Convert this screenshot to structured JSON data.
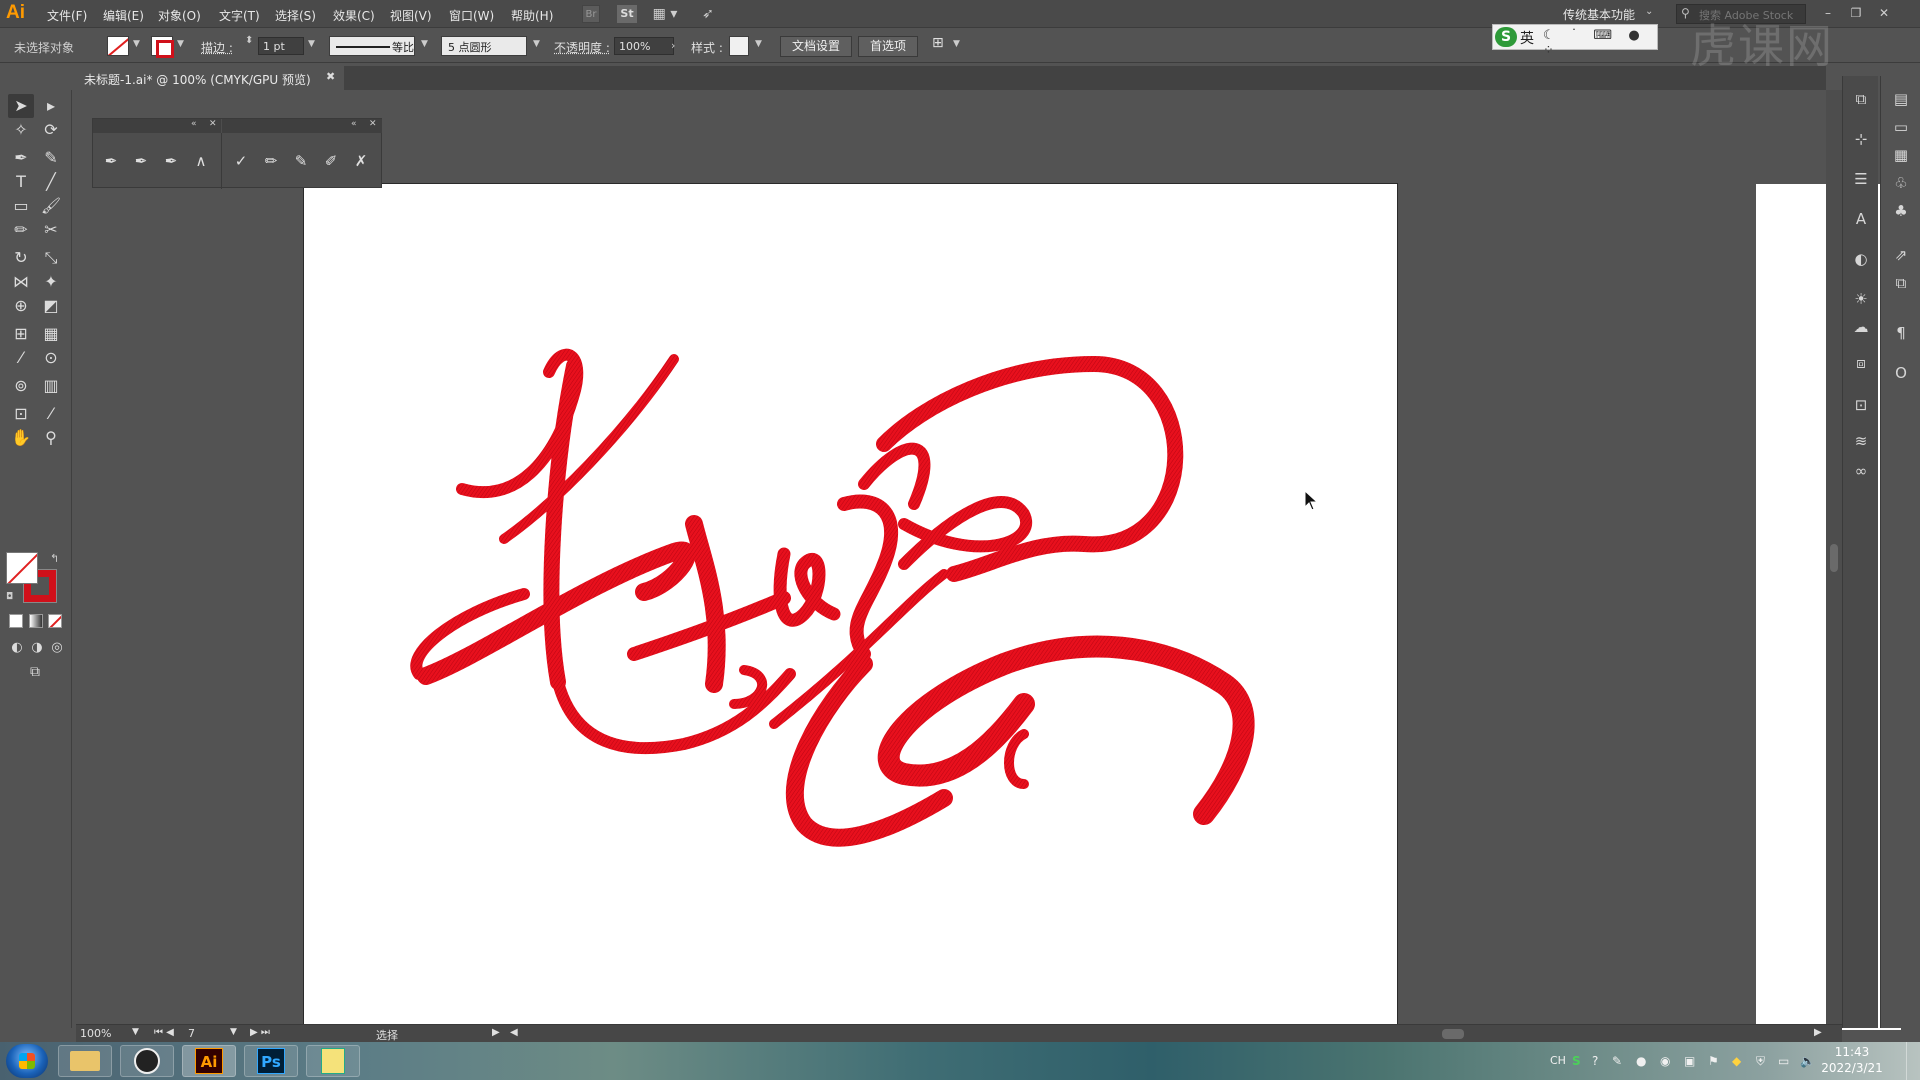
{
  "app": {
    "logo": "Ai",
    "menu": [
      "文件(F)",
      "编辑(E)",
      "对象(O)",
      "文字(T)",
      "选择(S)",
      "效果(C)",
      "视图(V)",
      "窗口(W)",
      "帮助(H)"
    ],
    "icons": [
      "bridge-icon",
      "stock-icon",
      "arrange-documents-icon",
      "gpu-performance-icon"
    ],
    "bridge_text": "Br",
    "stock_text": "St",
    "workspace": "传统基本功能",
    "search_placeholder": "搜索 Adobe Stock",
    "window_buttons": [
      "minimize",
      "restore",
      "close"
    ]
  },
  "ime": {
    "logo": "S",
    "language": "英",
    "icons": [
      "moon-icon",
      "punctuation-icon",
      "keyboard-icon",
      "user-icon",
      "grid-icon"
    ]
  },
  "watermark": "虎课网",
  "controlbar": {
    "selection_label": "未选择对象",
    "stroke_label": "描边 :",
    "stroke_weight": "1 pt",
    "stroke_profile": "等比",
    "brush": "5 点圆形",
    "opacity_label": "不透明度 :",
    "opacity_value": "100%",
    "style_label": "样式 :",
    "doc_setup_button": "文档设置",
    "preferences_button": "首选项",
    "colors": {
      "fill": "none",
      "stroke": "#d0101a"
    }
  },
  "document": {
    "tab_title": "未标题-1.ai* @ 100% (CMYK/GPU 预览)",
    "artwork_description_color": "#e0101c"
  },
  "status": {
    "zoom": "100%",
    "artboard_number": "7",
    "tool_name": "选择"
  },
  "taskbar": {
    "apps": [
      {
        "name": "file-explorer",
        "label": ""
      },
      {
        "name": "obs",
        "label": ""
      },
      {
        "name": "illustrator",
        "label": "Ai"
      },
      {
        "name": "photoshop",
        "label": "Ps"
      },
      {
        "name": "notepad",
        "label": ""
      }
    ],
    "tray_lang": "CH",
    "time": "11:43",
    "date": "2022/3/21"
  }
}
